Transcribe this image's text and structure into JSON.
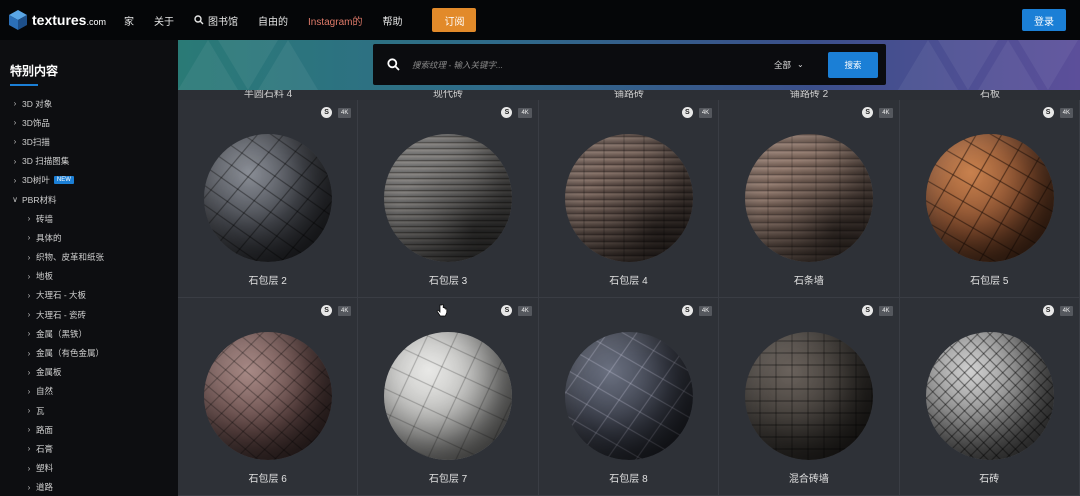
{
  "brand": {
    "name": "textures",
    "suffix": ".com"
  },
  "nav": {
    "items": [
      "家",
      "关于",
      "图书馆",
      "自由的",
      "Instagram的",
      "帮助"
    ],
    "subscribe_label": "订阅",
    "login_label": "登录"
  },
  "sidebar": {
    "title": "特别内容",
    "items": [
      {
        "label": "3D 对象",
        "sub": false,
        "open": false
      },
      {
        "label": "3D饰品",
        "sub": false,
        "open": false
      },
      {
        "label": "3D扫描",
        "sub": false,
        "open": false
      },
      {
        "label": "3D 扫描图集",
        "sub": false,
        "open": false
      },
      {
        "label": "3D树叶",
        "sub": false,
        "open": false,
        "badge": "NEW"
      },
      {
        "label": "PBR材料",
        "sub": false,
        "open": true
      },
      {
        "label": "砖墙",
        "sub": true
      },
      {
        "label": "具体的",
        "sub": true
      },
      {
        "label": "织物、皮革和纸张",
        "sub": true
      },
      {
        "label": "地板",
        "sub": true
      },
      {
        "label": "大理石 - 大板",
        "sub": true
      },
      {
        "label": "大理石 - 瓷砖",
        "sub": true
      },
      {
        "label": "金属（黑铁）",
        "sub": true
      },
      {
        "label": "金属（有色金属）",
        "sub": true
      },
      {
        "label": "金属板",
        "sub": true
      },
      {
        "label": "自然",
        "sub": true
      },
      {
        "label": "瓦",
        "sub": true
      },
      {
        "label": "路面",
        "sub": true
      },
      {
        "label": "石膏",
        "sub": true
      },
      {
        "label": "塑料",
        "sub": true
      },
      {
        "label": "道路",
        "sub": true
      }
    ]
  },
  "search": {
    "placeholder": "搜索纹理 - 输入关键字...",
    "scope": "全部",
    "button_label": "搜索"
  },
  "cut_labels": [
    "半圆石料 4",
    "现代砖",
    "铺路砖",
    "铺路砖 2",
    "石板"
  ],
  "cards": [
    {
      "name": "石包层 2",
      "badge": "4K",
      "icon": "substance-icon"
    },
    {
      "name": "石包层 3",
      "badge": "4K",
      "icon": "substance-icon"
    },
    {
      "name": "石包层 4",
      "badge": "4K",
      "icon": "substance-icon"
    },
    {
      "name": "石条墙",
      "badge": "4K",
      "icon": "substance-icon"
    },
    {
      "name": "石包层 5",
      "badge": "4K",
      "icon": "substance-icon"
    },
    {
      "name": "石包层 6",
      "badge": "4K",
      "icon": "substance-icon"
    },
    {
      "name": "石包层 7",
      "badge": "4K",
      "icon": "substance-icon"
    },
    {
      "name": "石包层 8",
      "badge": "4K",
      "icon": "substance-icon"
    },
    {
      "name": "混合砖墙",
      "badge": "4K",
      "icon": "substance-icon"
    },
    {
      "name": "石砖",
      "badge": "4K",
      "icon": "substance-icon"
    }
  ],
  "colors": {
    "accent": "#1b7fd6",
    "subscribe": "#e28a2a",
    "instagram": "#e07b6a"
  }
}
